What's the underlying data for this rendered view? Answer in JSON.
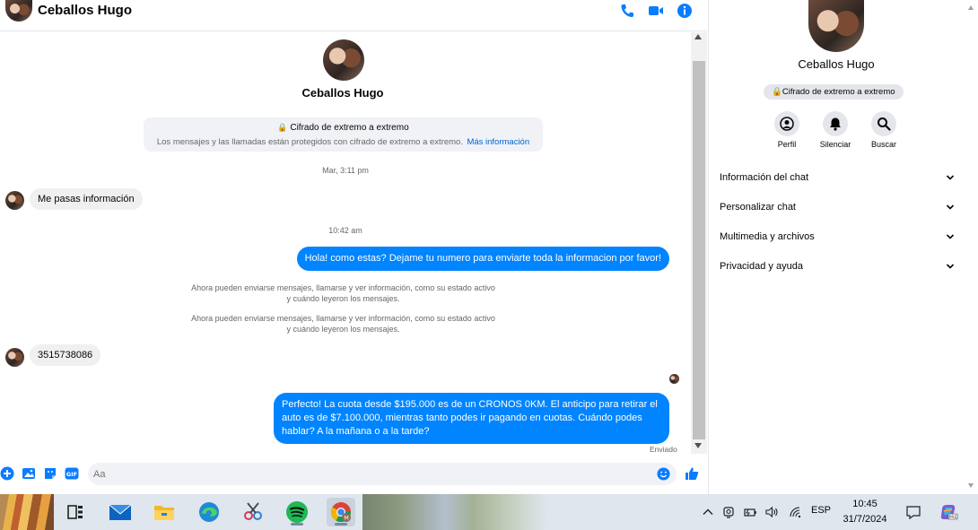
{
  "header": {
    "contact_name": "Ceballos Hugo",
    "icons": [
      "phone-icon",
      "video-icon",
      "info-icon"
    ]
  },
  "conversation": {
    "contact_name": "Ceballos Hugo",
    "encryption": {
      "title": "Cifrado de extremo a extremo",
      "description": "Los mensajes y las llamadas están protegidos con cifrado de extremo a extremo.",
      "link": "Más información"
    },
    "timestamp_1": "Mar, 3:11 pm",
    "message_1": "Me pasas información",
    "timestamp_2": "10:42 am",
    "message_2": "Hola! como estas? Dejame tu numero para enviarte toda la informacion por favor!",
    "system_1": "Ahora pueden enviarse mensajes, llamarse y ver información, como su estado activo y cuándo leyeron los mensajes.",
    "system_2": "Ahora pueden enviarse mensajes, llamarse y ver información, como su estado activo y cuándo leyeron los mensajes.",
    "message_3": "3515738086",
    "message_4": "Perfecto! La cuota desde $195.000 es de un CRONOS 0KM. El anticipo para retirar el auto es de $7.100.000, mientras tanto podes ir pagando en cuotas. Cuándo podes hablar? A la mañana o a la tarde?",
    "status": "Enviado"
  },
  "composer": {
    "placeholder": "Aa",
    "icons": [
      "plus-icon",
      "image-icon",
      "sticker-icon",
      "gif-icon",
      "emoji-icon",
      "like-icon"
    ]
  },
  "details": {
    "contact_name": "Ceballos Hugo",
    "encryption_badge": "Cifrado de extremo a extremo",
    "actions": [
      {
        "label": "Perfil",
        "icon": "profile-icon"
      },
      {
        "label": "Silenciar",
        "icon": "bell-icon"
      },
      {
        "label": "Buscar",
        "icon": "search-icon"
      }
    ],
    "sections": [
      {
        "label": "Información del chat"
      },
      {
        "label": "Personalizar chat"
      },
      {
        "label": "Multimedia y archivos"
      },
      {
        "label": "Privacidad y ayuda"
      }
    ]
  },
  "taskbar": {
    "apps": [
      "task-view-icon",
      "mail-icon",
      "file-explorer-icon",
      "edge-icon",
      "snipping-tool-icon",
      "spotify-icon",
      "chrome-icon"
    ],
    "language": "ESP",
    "time": "10:45",
    "date": "31/7/2024"
  },
  "colors": {
    "accent": "#0084ff",
    "link": "#0064d1",
    "bubble_in": "#f0f0f0",
    "taskbar": "#dfe6ee"
  }
}
